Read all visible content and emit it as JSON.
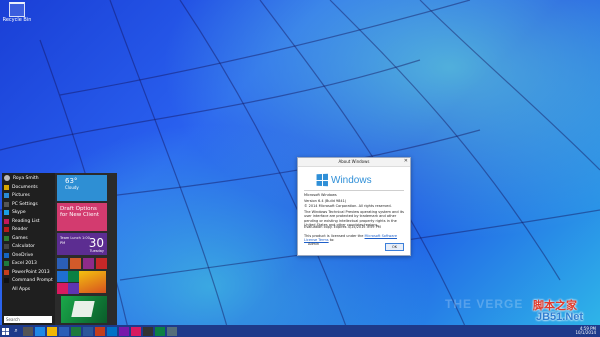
{
  "desktop": {
    "recycle_bin_label": "Recycle Bin",
    "wallpaper_colors": [
      "#1a3fd6",
      "#2a62f0",
      "#2fb8e8",
      "#78ffd2"
    ]
  },
  "start_menu": {
    "user_name": "Roya Smith",
    "apps": [
      {
        "label": "Documents",
        "color": "#d7a600"
      },
      {
        "label": "Pictures",
        "color": "#2a8bd6"
      },
      {
        "label": "PC Settings",
        "color": "#555555"
      },
      {
        "label": "Skype",
        "color": "#1b9ee4"
      },
      {
        "label": "Reading List",
        "color": "#c2185b"
      },
      {
        "label": "Reader",
        "color": "#b71c1c"
      },
      {
        "label": "Games",
        "color": "#2e7d32"
      },
      {
        "label": "Calculator",
        "color": "#444444"
      },
      {
        "label": "OneDrive",
        "color": "#1565c0"
      },
      {
        "label": "Excel 2013",
        "color": "#1f7a3d"
      },
      {
        "label": "PowerPoint 2013",
        "color": "#c43e1c"
      },
      {
        "label": "Command Prompt",
        "color": "#111111"
      },
      {
        "label": "All Apps",
        "color": "#1f1f1f"
      }
    ],
    "search_placeholder": "Search",
    "tiles": {
      "weather_temp": "63°",
      "weather_condition": "Cloudy",
      "mail_subject": "Draft Options for New Client",
      "calendar_meta": "Team Lunch 1:00 PM",
      "calendar_day": "30",
      "calendar_weekday": "Tuesday"
    },
    "accent": "#d33b6f"
  },
  "about_dialog": {
    "title": "About Windows",
    "wordmark": "Windows",
    "lines": [
      "Microsoft Windows",
      "Version 6.4 (Build 9841)",
      "© 2014 Microsoft Corporation. All rights reserved.",
      "The Windows Technical Preview operating system and its user interface are protected by trademark and other pending or existing intellectual property rights in the United States and other countries/regions."
    ],
    "evaluation": "Evaluation copy. Expires 4/15/2015 4:59 PM",
    "license_prefix": "This product is licensed under the",
    "license_link": "Microsoft Software License Terms",
    "license_suffix": "to:",
    "licensee": "Admin",
    "ok_label": "OK"
  },
  "taskbar": {
    "time": "4:59 PM",
    "date": "10/1/2014",
    "color": "#1e3a8a"
  },
  "watermarks": {
    "verge": "THE VERGE",
    "site_cn": "脚本之家",
    "site": "JB51.Net"
  }
}
